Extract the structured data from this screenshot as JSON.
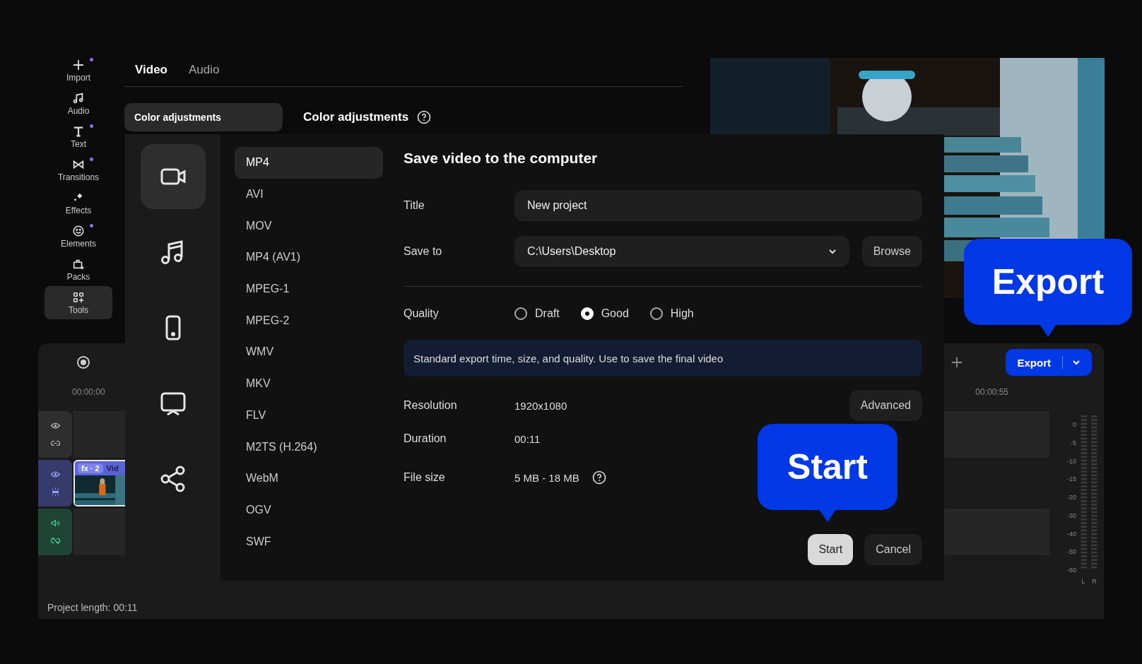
{
  "sidebar": {
    "items": [
      {
        "label": "Import",
        "new_dot": true,
        "selected": false
      },
      {
        "label": "Audio",
        "new_dot": false,
        "selected": false
      },
      {
        "label": "Text",
        "new_dot": true,
        "selected": false
      },
      {
        "label": "Transitions",
        "new_dot": true,
        "selected": false
      },
      {
        "label": "Effects",
        "new_dot": false,
        "selected": false
      },
      {
        "label": "Elements",
        "new_dot": true,
        "selected": false
      },
      {
        "label": "Packs",
        "new_dot": false,
        "selected": false
      },
      {
        "label": "Tools",
        "new_dot": false,
        "selected": true
      }
    ]
  },
  "tabs": [
    {
      "label": "Video",
      "selected": true
    },
    {
      "label": "Audio",
      "selected": false
    }
  ],
  "panel": {
    "pill": "Color adjustments",
    "heading": "Color adjustments"
  },
  "timeline": {
    "time_start": "00:00:00",
    "time_end": "00:00:55",
    "export_button": "Export",
    "clip": {
      "badge": "fx · 2",
      "title": "Vid"
    },
    "meter_labels": [
      "0",
      "-5",
      "-10",
      "-15",
      "-20",
      "-30",
      "-40",
      "-50",
      "-60"
    ],
    "channels": [
      "L",
      "R"
    ],
    "project_length": "Project length: 00:11"
  },
  "export_dialog": {
    "categories": [
      {
        "selected": true
      },
      {
        "selected": false
      },
      {
        "selected": false
      },
      {
        "selected": false
      },
      {
        "selected": false
      }
    ],
    "formats": [
      {
        "label": "MP4",
        "selected": true
      },
      {
        "label": "AVI",
        "selected": false
      },
      {
        "label": "MOV",
        "selected": false
      },
      {
        "label": "MP4 (AV1)",
        "selected": false
      },
      {
        "label": "MPEG-1",
        "selected": false
      },
      {
        "label": "MPEG-2",
        "selected": false
      },
      {
        "label": "WMV",
        "selected": false
      },
      {
        "label": "MKV",
        "selected": false
      },
      {
        "label": "FLV",
        "selected": false
      },
      {
        "label": "M2TS (H.264)",
        "selected": false
      },
      {
        "label": "WebM",
        "selected": false
      },
      {
        "label": "OGV",
        "selected": false
      },
      {
        "label": "SWF",
        "selected": false
      }
    ],
    "title": "Save video to the computer",
    "title_field": {
      "label": "Title",
      "value": "New project"
    },
    "save_to": {
      "label": "Save to",
      "value": "C:\\Users\\Desktop",
      "browse": "Browse"
    },
    "quality": {
      "label": "Quality",
      "options": [
        {
          "label": "Draft",
          "selected": false
        },
        {
          "label": "Good",
          "selected": true
        },
        {
          "label": "High",
          "selected": false
        }
      ]
    },
    "info": "Standard export time, size, and quality. Use to save the final video",
    "specs": [
      {
        "label": "Resolution",
        "value": "1920x1080"
      },
      {
        "label": "Duration",
        "value": "00:11"
      },
      {
        "label": "File size",
        "value": "5 MB - 18 MB"
      }
    ],
    "advanced_button": "Advanced",
    "start_button": "Start",
    "cancel_button": "Cancel"
  },
  "callouts": [
    {
      "label": "Export"
    },
    {
      "label": "Start"
    }
  ]
}
